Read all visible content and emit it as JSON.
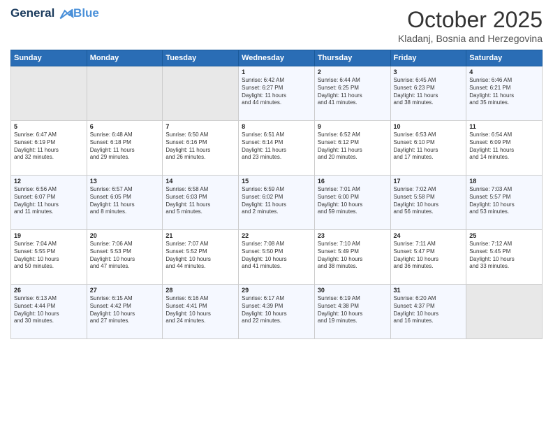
{
  "header": {
    "logo_line1": "General",
    "logo_line2": "Blue",
    "month_title": "October 2025",
    "location": "Kladanj, Bosnia and Herzegovina"
  },
  "weekdays": [
    "Sunday",
    "Monday",
    "Tuesday",
    "Wednesday",
    "Thursday",
    "Friday",
    "Saturday"
  ],
  "weeks": [
    [
      {
        "day": "",
        "content": ""
      },
      {
        "day": "",
        "content": ""
      },
      {
        "day": "",
        "content": ""
      },
      {
        "day": "1",
        "content": "Sunrise: 6:42 AM\nSunset: 6:27 PM\nDaylight: 11 hours\nand 44 minutes."
      },
      {
        "day": "2",
        "content": "Sunrise: 6:44 AM\nSunset: 6:25 PM\nDaylight: 11 hours\nand 41 minutes."
      },
      {
        "day": "3",
        "content": "Sunrise: 6:45 AM\nSunset: 6:23 PM\nDaylight: 11 hours\nand 38 minutes."
      },
      {
        "day": "4",
        "content": "Sunrise: 6:46 AM\nSunset: 6:21 PM\nDaylight: 11 hours\nand 35 minutes."
      }
    ],
    [
      {
        "day": "5",
        "content": "Sunrise: 6:47 AM\nSunset: 6:19 PM\nDaylight: 11 hours\nand 32 minutes."
      },
      {
        "day": "6",
        "content": "Sunrise: 6:48 AM\nSunset: 6:18 PM\nDaylight: 11 hours\nand 29 minutes."
      },
      {
        "day": "7",
        "content": "Sunrise: 6:50 AM\nSunset: 6:16 PM\nDaylight: 11 hours\nand 26 minutes."
      },
      {
        "day": "8",
        "content": "Sunrise: 6:51 AM\nSunset: 6:14 PM\nDaylight: 11 hours\nand 23 minutes."
      },
      {
        "day": "9",
        "content": "Sunrise: 6:52 AM\nSunset: 6:12 PM\nDaylight: 11 hours\nand 20 minutes."
      },
      {
        "day": "10",
        "content": "Sunrise: 6:53 AM\nSunset: 6:10 PM\nDaylight: 11 hours\nand 17 minutes."
      },
      {
        "day": "11",
        "content": "Sunrise: 6:54 AM\nSunset: 6:09 PM\nDaylight: 11 hours\nand 14 minutes."
      }
    ],
    [
      {
        "day": "12",
        "content": "Sunrise: 6:56 AM\nSunset: 6:07 PM\nDaylight: 11 hours\nand 11 minutes."
      },
      {
        "day": "13",
        "content": "Sunrise: 6:57 AM\nSunset: 6:05 PM\nDaylight: 11 hours\nand 8 minutes."
      },
      {
        "day": "14",
        "content": "Sunrise: 6:58 AM\nSunset: 6:03 PM\nDaylight: 11 hours\nand 5 minutes."
      },
      {
        "day": "15",
        "content": "Sunrise: 6:59 AM\nSunset: 6:02 PM\nDaylight: 11 hours\nand 2 minutes."
      },
      {
        "day": "16",
        "content": "Sunrise: 7:01 AM\nSunset: 6:00 PM\nDaylight: 10 hours\nand 59 minutes."
      },
      {
        "day": "17",
        "content": "Sunrise: 7:02 AM\nSunset: 5:58 PM\nDaylight: 10 hours\nand 56 minutes."
      },
      {
        "day": "18",
        "content": "Sunrise: 7:03 AM\nSunset: 5:57 PM\nDaylight: 10 hours\nand 53 minutes."
      }
    ],
    [
      {
        "day": "19",
        "content": "Sunrise: 7:04 AM\nSunset: 5:55 PM\nDaylight: 10 hours\nand 50 minutes."
      },
      {
        "day": "20",
        "content": "Sunrise: 7:06 AM\nSunset: 5:53 PM\nDaylight: 10 hours\nand 47 minutes."
      },
      {
        "day": "21",
        "content": "Sunrise: 7:07 AM\nSunset: 5:52 PM\nDaylight: 10 hours\nand 44 minutes."
      },
      {
        "day": "22",
        "content": "Sunrise: 7:08 AM\nSunset: 5:50 PM\nDaylight: 10 hours\nand 41 minutes."
      },
      {
        "day": "23",
        "content": "Sunrise: 7:10 AM\nSunset: 5:49 PM\nDaylight: 10 hours\nand 38 minutes."
      },
      {
        "day": "24",
        "content": "Sunrise: 7:11 AM\nSunset: 5:47 PM\nDaylight: 10 hours\nand 36 minutes."
      },
      {
        "day": "25",
        "content": "Sunrise: 7:12 AM\nSunset: 5:45 PM\nDaylight: 10 hours\nand 33 minutes."
      }
    ],
    [
      {
        "day": "26",
        "content": "Sunrise: 6:13 AM\nSunset: 4:44 PM\nDaylight: 10 hours\nand 30 minutes."
      },
      {
        "day": "27",
        "content": "Sunrise: 6:15 AM\nSunset: 4:42 PM\nDaylight: 10 hours\nand 27 minutes."
      },
      {
        "day": "28",
        "content": "Sunrise: 6:16 AM\nSunset: 4:41 PM\nDaylight: 10 hours\nand 24 minutes."
      },
      {
        "day": "29",
        "content": "Sunrise: 6:17 AM\nSunset: 4:39 PM\nDaylight: 10 hours\nand 22 minutes."
      },
      {
        "day": "30",
        "content": "Sunrise: 6:19 AM\nSunset: 4:38 PM\nDaylight: 10 hours\nand 19 minutes."
      },
      {
        "day": "31",
        "content": "Sunrise: 6:20 AM\nSunset: 4:37 PM\nDaylight: 10 hours\nand 16 minutes."
      },
      {
        "day": "",
        "content": ""
      }
    ]
  ]
}
